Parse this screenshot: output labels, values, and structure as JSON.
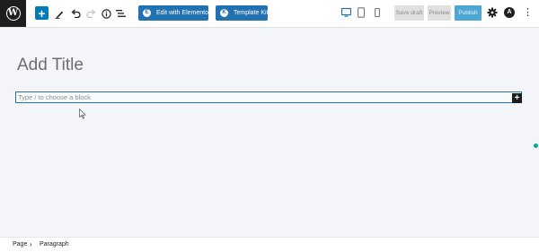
{
  "toolbar": {
    "wp_logo_letter": "W",
    "add_block_symbol": "+",
    "edit_with_elementor": "Edit with Elementor",
    "elementor_icon_letter": "E",
    "template_kits": "Template Kits",
    "kits_icon_letter": "K",
    "save_draft": "Save draft",
    "preview": "Preview",
    "publish": "Publish",
    "astra_letter": "A",
    "more_symbol": "⋮",
    "icons": {
      "add": "plus-icon",
      "tools": "pencil-icon",
      "undo": "undo-icon",
      "redo": "redo-icon",
      "details": "info-icon",
      "outline": "list-view-icon",
      "desktop": "desktop-icon",
      "tablet": "tablet-icon",
      "mobile": "mobile-icon",
      "settings": "gear-icon",
      "astra": "astra-icon",
      "more": "more-vertical-icon"
    },
    "accent_color": "#007cba",
    "elementor_color": "#2271b1"
  },
  "editor": {
    "title_placeholder": "Add Title",
    "block_placeholder": "Type / to choose a block",
    "inserter_symbol": "+"
  },
  "footer": {
    "breadcrumb": [
      "Page",
      "Paragraph"
    ],
    "separator": "›"
  }
}
